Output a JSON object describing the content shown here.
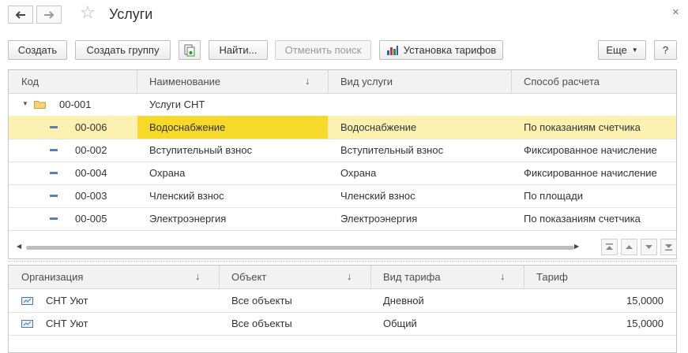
{
  "window": {
    "title": "Услуги",
    "close_glyph": "×"
  },
  "icons": {
    "back": "back-arrow-icon",
    "forward": "forward-arrow-icon",
    "favorite": "star-icon",
    "close": "close-icon",
    "copy": "copy-icon",
    "tariffs": "bar-chart-icon",
    "folder": "folder-icon",
    "item": "item-icon",
    "org": "organization-icon"
  },
  "toolbar": {
    "create": "Создать",
    "create_group": "Создать группу",
    "find": "Найти...",
    "cancel_search": "Отменить поиск",
    "set_tariffs": "Установка тарифов",
    "more": "Еще",
    "help": "?"
  },
  "services": {
    "columns": [
      "Код",
      "Наименование",
      "Вид услуги",
      "Способ расчета"
    ],
    "sort_glyph": "↓",
    "group": {
      "code": "00-001",
      "name": "Услуги СНТ"
    },
    "rows": [
      {
        "code": "00-006",
        "name": "Водоснабжение",
        "type": "Водоснабжение",
        "method": "По показаниям счетчика",
        "selected": true
      },
      {
        "code": "00-002",
        "name": "Вступительный взнос",
        "type": "Вступительный взнос",
        "method": "Фиксированное начисление"
      },
      {
        "code": "00-004",
        "name": "Охрана",
        "type": "Охрана",
        "method": "Фиксированное начисление"
      },
      {
        "code": "00-003",
        "name": "Членский взнос",
        "type": "Членский взнос",
        "method": "По площади"
      },
      {
        "code": "00-005",
        "name": "Электроэнергия",
        "type": "Электроэнергия",
        "method": "По показаниям счетчика"
      }
    ]
  },
  "tariffs": {
    "columns": [
      "Организация",
      "Объект",
      "Вид тарифа",
      "Тариф"
    ],
    "rows": [
      {
        "org": "СНТ Уют",
        "object": "Все объекты",
        "kind": "Дневной",
        "tariff": "15,0000"
      },
      {
        "org": "СНТ Уют",
        "object": "Все объекты",
        "kind": "Общий",
        "tariff": "15,0000"
      }
    ]
  },
  "colors": {
    "selected_row": "#fcf1b0",
    "selected_cell": "#f7d92c",
    "border": "#c5c5c5",
    "header_bg": "#f2f2f2"
  }
}
